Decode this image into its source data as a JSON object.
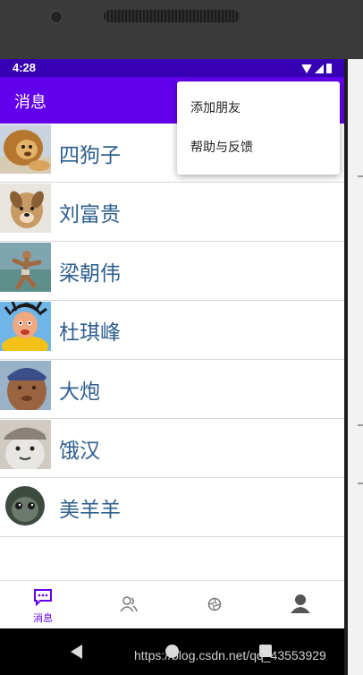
{
  "status_bar": {
    "time": "4:28"
  },
  "app_bar": {
    "title": "消息"
  },
  "overflow_menu": {
    "items": [
      "添加朋友",
      "帮助与反馈"
    ]
  },
  "contacts": [
    {
      "name": "四狗子",
      "avatar": "lion-avatar"
    },
    {
      "name": "刘富贵",
      "avatar": "dog-avatar"
    },
    {
      "name": "梁朝伟",
      "avatar": "dancing-man-avatar"
    },
    {
      "name": "杜琪峰",
      "avatar": "cartoon-man-avatar"
    },
    {
      "name": "大炮",
      "avatar": "man-with-cap-avatar"
    },
    {
      "name": "饿汉",
      "avatar": "bear-with-hat-avatar"
    },
    {
      "name": "美羊羊",
      "avatar": "sheep-avatar"
    }
  ],
  "bottom_nav": [
    {
      "label": "消息",
      "icon": "message-icon",
      "active": true
    },
    {
      "label": "",
      "icon": "contacts-icon",
      "active": false
    },
    {
      "label": "",
      "icon": "discover-icon",
      "active": false
    },
    {
      "label": "",
      "icon": "profile-icon",
      "active": false
    }
  ],
  "watermark": "https://blog.csdn.net/qq_43553929",
  "colors": {
    "status_bar": "#3700b3",
    "app_bar": "#6200ee",
    "name_text": "#2f5f8f",
    "active_nav": "#6200ee"
  }
}
